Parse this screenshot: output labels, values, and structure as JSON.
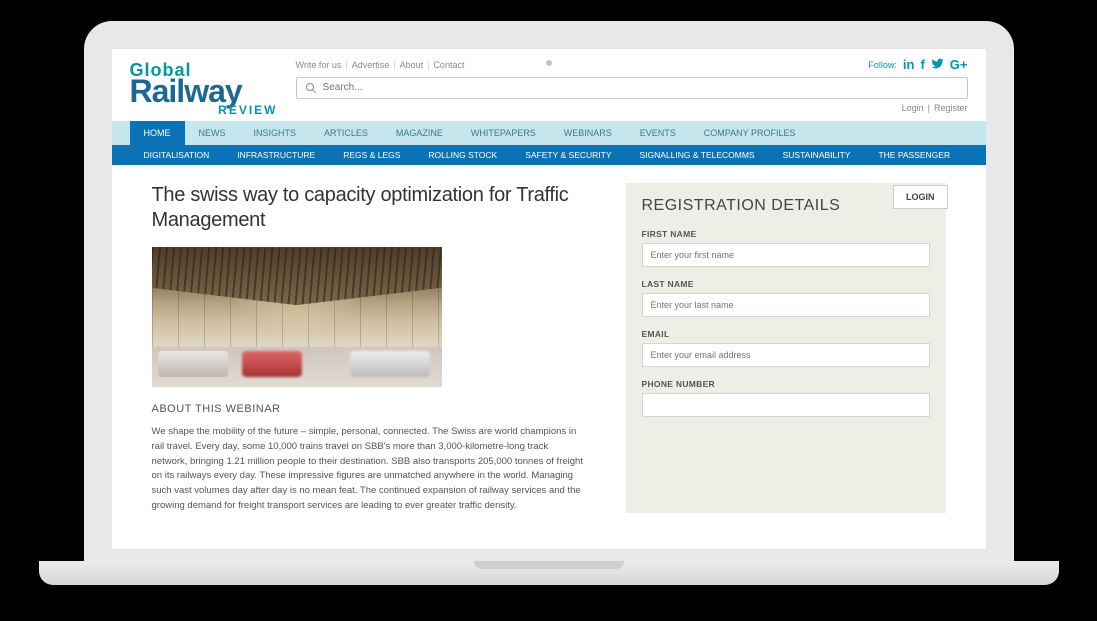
{
  "logo": {
    "line1": "Global",
    "line2": "Railway",
    "line3": "REVIEW"
  },
  "toplinks": [
    "Write for us",
    "Advertise",
    "About",
    "Contact"
  ],
  "follow_label": "Follow:",
  "search": {
    "placeholder": "Search..."
  },
  "auth": {
    "login": "Login",
    "register": "Register"
  },
  "nav_primary": [
    "HOME",
    "NEWS",
    "INSIGHTS",
    "ARTICLES",
    "MAGAZINE",
    "WHITEPAPERS",
    "WEBINARS",
    "EVENTS",
    "COMPANY PROFILES"
  ],
  "nav_secondary": [
    "DIGITALISATION",
    "INFRASTRUCTURE",
    "REGS & LEGS",
    "ROLLING STOCK",
    "SAFETY & SECURITY",
    "SIGNALLING & TELECOMMS",
    "SUSTAINABILITY",
    "THE PASSENGER"
  ],
  "article": {
    "title": "The swiss way to capacity optimization for Traffic Management",
    "section_label": "ABOUT THIS WEBINAR",
    "body": "We shape the mobility of the future – simple, personal, connected. The Swiss are world champions in rail travel. Every day, some 10,000 trains travel on SBB's more than 3,000-kilometre-long track network, bringing 1.21 million people to their destination. SBB also transports 205,000 tonnes of freight on its railways every day. These impressive figures are unmatched anywhere in the world. Managing such vast volumes day after day is no mean feat. The continued expansion of railway services and the growing demand for freight transport services are leading to ever greater traffic density."
  },
  "registration": {
    "title": "REGISTRATION DETAILS",
    "login_button": "LOGIN",
    "fields": {
      "first_name": {
        "label": "FIRST NAME",
        "placeholder": "Enter your first name"
      },
      "last_name": {
        "label": "LAST NAME",
        "placeholder": "Enter your last name"
      },
      "email": {
        "label": "EMAIL",
        "placeholder": "Enter your email address"
      },
      "phone": {
        "label": "PHONE NUMBER",
        "placeholder": ""
      }
    }
  }
}
